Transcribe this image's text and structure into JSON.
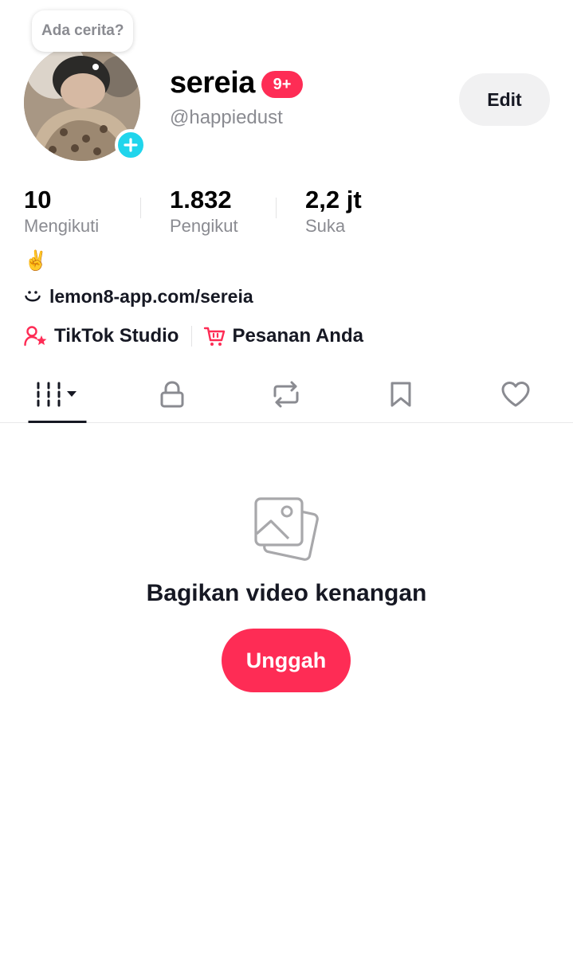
{
  "profile": {
    "story_prompt": "Ada cerita?",
    "username": "sereia",
    "notification_badge": "9+",
    "handle": "@happiedust",
    "edit_label": "Edit"
  },
  "stats": [
    {
      "value": "10",
      "label": "Mengikuti"
    },
    {
      "value": "1.832",
      "label": "Pengikut"
    },
    {
      "value": "2,2 jt",
      "label": "Suka"
    }
  ],
  "bio": {
    "emoji": "✌️",
    "link": "lemon8-app.com/sereia"
  },
  "quick_links": [
    {
      "label": "TikTok Studio",
      "icon": "person-star-icon"
    },
    {
      "label": "Pesanan Anda",
      "icon": "cart-icon"
    }
  ],
  "tabs": [
    {
      "name": "videos",
      "icon": "grid-sort-icon",
      "active": true
    },
    {
      "name": "private",
      "icon": "lock-icon",
      "active": false
    },
    {
      "name": "reposts",
      "icon": "repost-icon",
      "active": false
    },
    {
      "name": "favorites",
      "icon": "bookmark-icon",
      "active": false
    },
    {
      "name": "liked",
      "icon": "heart-icon",
      "active": false
    }
  ],
  "empty_state": {
    "icon": "photos-icon",
    "title": "Bagikan video kenangan",
    "button_label": "Unggah"
  },
  "colors": {
    "accent": "#fe2c55",
    "story_add": "#20d5ec",
    "muted_text": "#8a8b91",
    "edit_button_bg": "#f1f1f2"
  }
}
